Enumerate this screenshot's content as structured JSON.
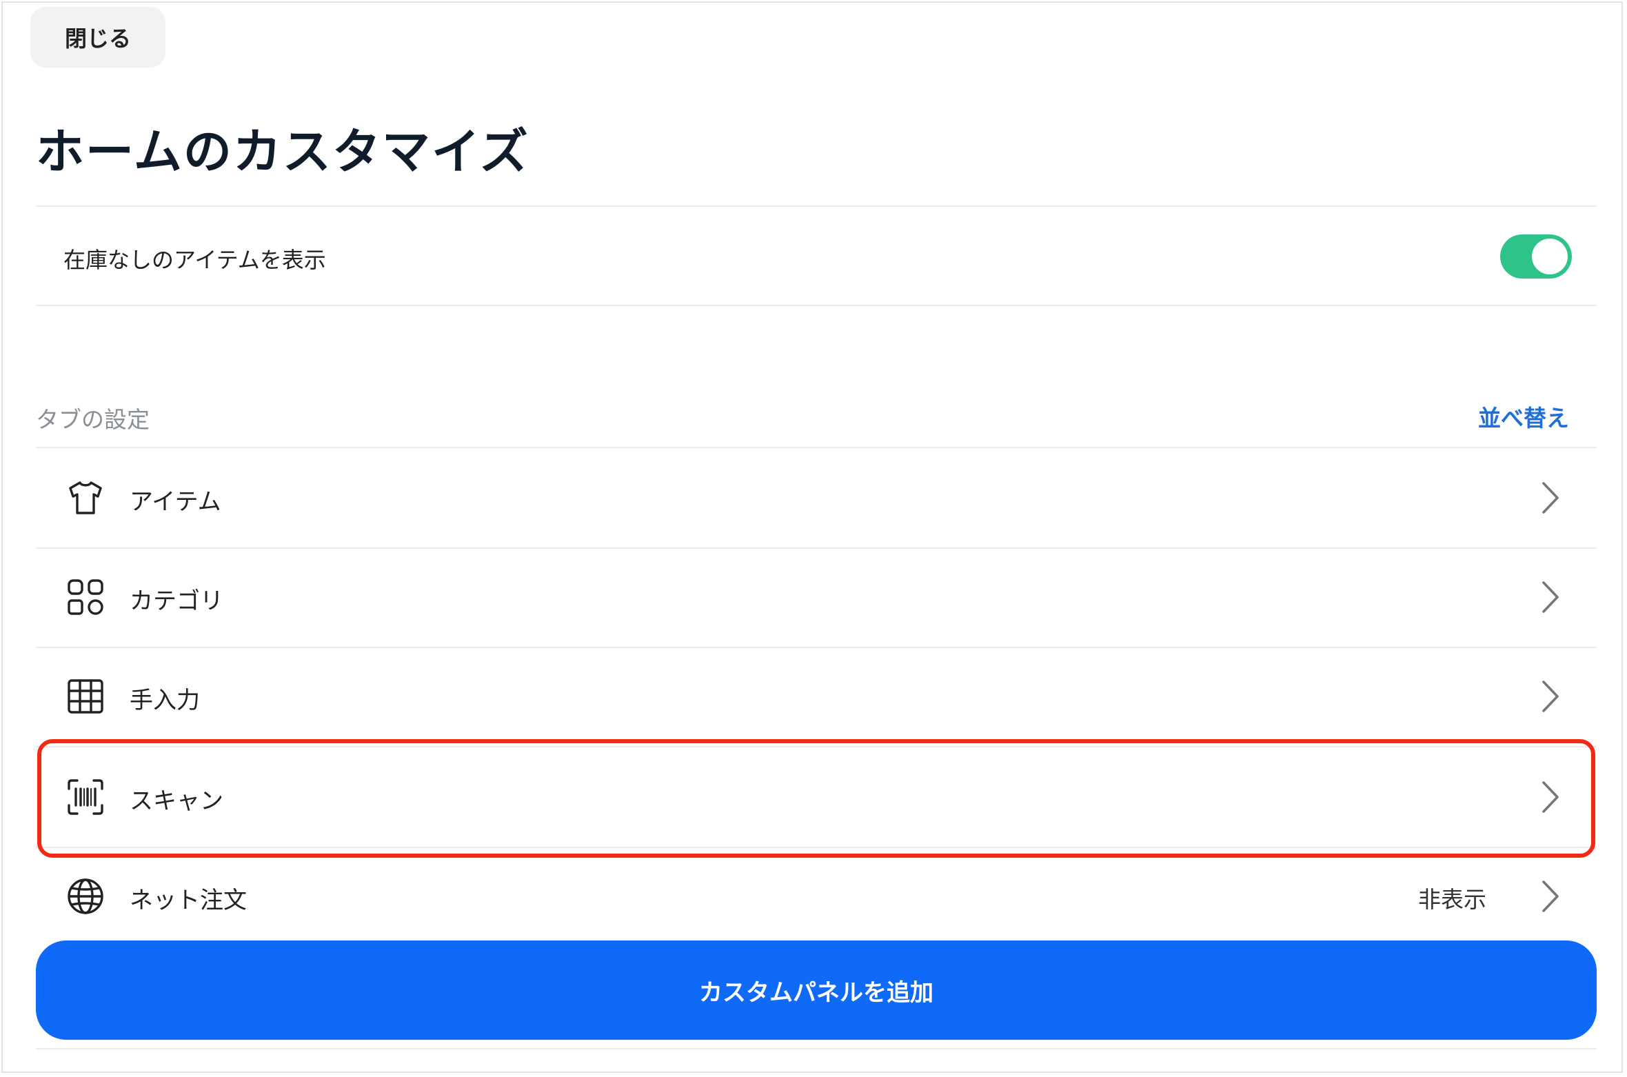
{
  "header": {
    "close_label": "閉じる",
    "title": "ホームのカスタマイズ"
  },
  "settings": {
    "show_out_of_stock_label": "在庫なしのアイテムを表示",
    "show_out_of_stock_enabled": true
  },
  "tabs_section": {
    "label": "タブの設定",
    "sort_label": "並べ替え",
    "items": [
      {
        "label": "アイテム",
        "icon": "shirt-icon",
        "status": ""
      },
      {
        "label": "カテゴリ",
        "icon": "grid-icon",
        "status": ""
      },
      {
        "label": "手入力",
        "icon": "keypad-icon",
        "status": ""
      },
      {
        "label": "スキャン",
        "icon": "barcode-scan-icon",
        "status": "",
        "highlighted": true
      },
      {
        "label": "ネット注文",
        "icon": "globe-icon",
        "status": "非表示"
      }
    ]
  },
  "footer": {
    "add_panel_label": "カスタムパネルを追加"
  },
  "colors": {
    "toggle_on": "#2ec388",
    "accent_blue": "#0f6af7",
    "link_blue": "#1f6fd6",
    "highlight_red": "#f22a14"
  }
}
